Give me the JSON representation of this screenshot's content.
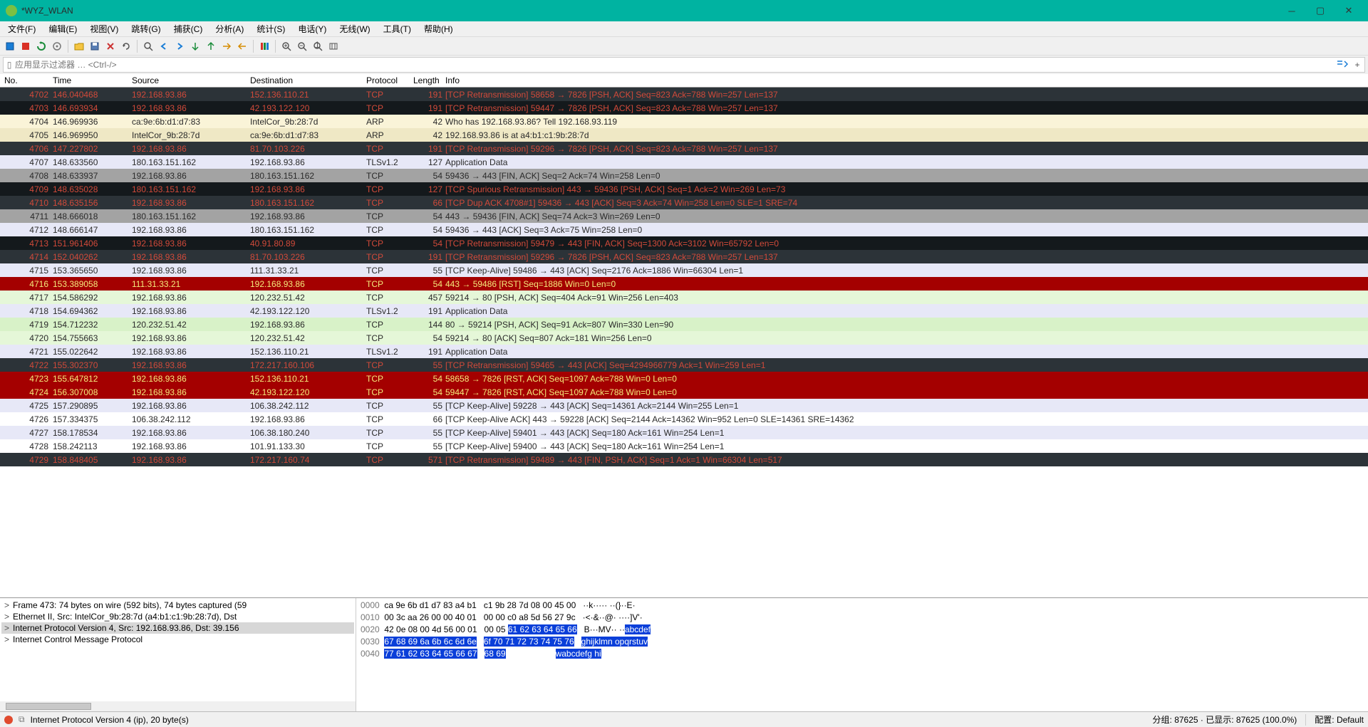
{
  "window": {
    "title": "*WYZ_WLAN"
  },
  "menu": {
    "items": [
      "文件(F)",
      "编辑(E)",
      "视图(V)",
      "跳转(G)",
      "捕获(C)",
      "分析(A)",
      "统计(S)",
      "电话(Y)",
      "无线(W)",
      "工具(T)",
      "帮助(H)"
    ]
  },
  "filter": {
    "placeholder": "应用显示过滤器 … <Ctrl-/>"
  },
  "columns": {
    "no": "No.",
    "time": "Time",
    "src": "Source",
    "dst": "Destination",
    "proto": "Protocol",
    "len": "Length",
    "info": "Info"
  },
  "packets": [
    {
      "no": "4702",
      "time": "146.040468",
      "src": "192.168.93.86",
      "dst": "152.136.110.21",
      "proto": "TCP",
      "len": "191",
      "info": "[TCP Retransmission] 58658 → 7826 [PSH, ACK] Seq=823 Ack=788 Win=257 Len=137",
      "cls": "cls-retrans-dark"
    },
    {
      "no": "4703",
      "time": "146.693934",
      "src": "192.168.93.86",
      "dst": "42.193.122.120",
      "proto": "TCP",
      "len": "191",
      "info": "[TCP Retransmission] 59447 → 7826 [PSH, ACK] Seq=823 Ack=788 Win=257 Len=137",
      "cls": "cls-retrans-dark2"
    },
    {
      "no": "4704",
      "time": "146.969936",
      "src": "ca:9e:6b:d1:d7:83",
      "dst": "IntelCor_9b:28:7d",
      "proto": "ARP",
      "len": "42",
      "info": "Who has 192.168.93.86? Tell 192.168.93.119",
      "cls": "cls-arp-light"
    },
    {
      "no": "4705",
      "time": "146.969950",
      "src": "IntelCor_9b:28:7d",
      "dst": "ca:9e:6b:d1:d7:83",
      "proto": "ARP",
      "len": "42",
      "info": "192.168.93.86 is at a4:b1:c1:9b:28:7d",
      "cls": "cls-arp-dark"
    },
    {
      "no": "4706",
      "time": "147.227802",
      "src": "192.168.93.86",
      "dst": "81.70.103.226",
      "proto": "TCP",
      "len": "191",
      "info": "[TCP Retransmission] 59296 → 7826 [PSH, ACK] Seq=823 Ack=788 Win=257 Len=137",
      "cls": "cls-retrans-dark"
    },
    {
      "no": "4707",
      "time": "148.633560",
      "src": "180.163.151.162",
      "dst": "192.168.93.86",
      "proto": "TLSv1.2",
      "len": "127",
      "info": "Application Data",
      "cls": "cls-light-blue"
    },
    {
      "no": "4708",
      "time": "148.633937",
      "src": "192.168.93.86",
      "dst": "180.163.151.162",
      "proto": "TCP",
      "len": "54",
      "info": "59436 → 443 [FIN, ACK] Seq=2 Ack=74 Win=258 Len=0",
      "cls": "cls-gray"
    },
    {
      "no": "4709",
      "time": "148.635028",
      "src": "180.163.151.162",
      "dst": "192.168.93.86",
      "proto": "TCP",
      "len": "127",
      "info": "[TCP Spurious Retransmission] 443 → 59436 [PSH, ACK] Seq=1 Ack=2 Win=269 Len=73",
      "cls": "cls-retrans-dark2"
    },
    {
      "no": "4710",
      "time": "148.635156",
      "src": "192.168.93.86",
      "dst": "180.163.151.162",
      "proto": "TCP",
      "len": "66",
      "info": "[TCP Dup ACK 4708#1] 59436 → 443 [ACK] Seq=3 Ack=74 Win=258 Len=0 SLE=1 SRE=74",
      "cls": "cls-retrans-dark"
    },
    {
      "no": "4711",
      "time": "148.666018",
      "src": "180.163.151.162",
      "dst": "192.168.93.86",
      "proto": "TCP",
      "len": "54",
      "info": "443 → 59436 [FIN, ACK] Seq=74 Ack=3 Win=269 Len=0",
      "cls": "cls-gray"
    },
    {
      "no": "4712",
      "time": "148.666147",
      "src": "192.168.93.86",
      "dst": "180.163.151.162",
      "proto": "TCP",
      "len": "54",
      "info": "59436 → 443 [ACK] Seq=3 Ack=75 Win=258 Len=0",
      "cls": "cls-light-blue"
    },
    {
      "no": "4713",
      "time": "151.961406",
      "src": "192.168.93.86",
      "dst": "40.91.80.89",
      "proto": "TCP",
      "len": "54",
      "info": "[TCP Retransmission] 59479 → 443 [FIN, ACK] Seq=1300 Ack=3102 Win=65792 Len=0",
      "cls": "cls-retrans-dark2"
    },
    {
      "no": "4714",
      "time": "152.040262",
      "src": "192.168.93.86",
      "dst": "81.70.103.226",
      "proto": "TCP",
      "len": "191",
      "info": "[TCP Retransmission] 59296 → 7826 [PSH, ACK] Seq=823 Ack=788 Win=257 Len=137",
      "cls": "cls-retrans-dark"
    },
    {
      "no": "4715",
      "time": "153.365650",
      "src": "192.168.93.86",
      "dst": "111.31.33.21",
      "proto": "TCP",
      "len": "55",
      "info": "[TCP Keep-Alive] 59486 → 443 [ACK] Seq=2176 Ack=1886 Win=66304 Len=1",
      "cls": "cls-light-blue"
    },
    {
      "no": "4716",
      "time": "153.389058",
      "src": "111.31.33.21",
      "dst": "192.168.93.86",
      "proto": "TCP",
      "len": "54",
      "info": "443 → 59486 [RST] Seq=1886 Win=0 Len=0",
      "cls": "cls-red-white"
    },
    {
      "no": "4717",
      "time": "154.586292",
      "src": "192.168.93.86",
      "dst": "120.232.51.42",
      "proto": "TCP",
      "len": "457",
      "info": "59214 → 80 [PSH, ACK] Seq=404 Ack=91 Win=256 Len=403",
      "cls": "cls-green-light"
    },
    {
      "no": "4718",
      "time": "154.694362",
      "src": "192.168.93.86",
      "dst": "42.193.122.120",
      "proto": "TLSv1.2",
      "len": "191",
      "info": "Application Data",
      "cls": "cls-light-blue"
    },
    {
      "no": "4719",
      "time": "154.712232",
      "src": "120.232.51.42",
      "dst": "192.168.93.86",
      "proto": "TCP",
      "len": "144",
      "info": "80 → 59214 [PSH, ACK] Seq=91 Ack=807 Win=330 Len=90",
      "cls": "cls-green-light2"
    },
    {
      "no": "4720",
      "time": "154.755663",
      "src": "192.168.93.86",
      "dst": "120.232.51.42",
      "proto": "TCP",
      "len": "54",
      "info": "59214 → 80 [ACK] Seq=807 Ack=181 Win=256 Len=0",
      "cls": "cls-green-light"
    },
    {
      "no": "4721",
      "time": "155.022642",
      "src": "192.168.93.86",
      "dst": "152.136.110.21",
      "proto": "TLSv1.2",
      "len": "191",
      "info": "Application Data",
      "cls": "cls-light-blue"
    },
    {
      "no": "4722",
      "time": "155.302370",
      "src": "192.168.93.86",
      "dst": "172.217.160.106",
      "proto": "TCP",
      "len": "55",
      "info": "[TCP Retransmission] 59465 → 443 [ACK] Seq=4294966779 Ack=1 Win=259 Len=1",
      "cls": "cls-retrans-dark"
    },
    {
      "no": "4723",
      "time": "155.647812",
      "src": "192.168.93.86",
      "dst": "152.136.110.21",
      "proto": "TCP",
      "len": "54",
      "info": "58658 → 7826 [RST, ACK] Seq=1097 Ack=788 Win=0 Len=0",
      "cls": "cls-red-white"
    },
    {
      "no": "4724",
      "time": "156.307008",
      "src": "192.168.93.86",
      "dst": "42.193.122.120",
      "proto": "TCP",
      "len": "54",
      "info": "59447 → 7826 [RST, ACK] Seq=1097 Ack=788 Win=0 Len=0",
      "cls": "cls-red-white"
    },
    {
      "no": "4725",
      "time": "157.290895",
      "src": "192.168.93.86",
      "dst": "106.38.242.112",
      "proto": "TCP",
      "len": "55",
      "info": "[TCP Keep-Alive] 59228 → 443 [ACK] Seq=14361 Ack=2144 Win=255 Len=1",
      "cls": "cls-light-blue"
    },
    {
      "no": "4726",
      "time": "157.334375",
      "src": "106.38.242.112",
      "dst": "192.168.93.86",
      "proto": "TCP",
      "len": "66",
      "info": "[TCP Keep-Alive ACK] 443 → 59228 [ACK] Seq=2144 Ack=14362 Win=952 Len=0 SLE=14361 SRE=14362",
      "cls": "cls-white"
    },
    {
      "no": "4727",
      "time": "158.178534",
      "src": "192.168.93.86",
      "dst": "106.38.180.240",
      "proto": "TCP",
      "len": "55",
      "info": "[TCP Keep-Alive] 59401 → 443 [ACK] Seq=180 Ack=161 Win=254 Len=1",
      "cls": "cls-light-blue"
    },
    {
      "no": "4728",
      "time": "158.242113",
      "src": "192.168.93.86",
      "dst": "101.91.133.30",
      "proto": "TCP",
      "len": "55",
      "info": "[TCP Keep-Alive] 59400 → 443 [ACK] Seq=180 Ack=161 Win=254 Len=1",
      "cls": "cls-white"
    },
    {
      "no": "4729",
      "time": "158.848405",
      "src": "192.168.93.86",
      "dst": "172.217.160.74",
      "proto": "TCP",
      "len": "571",
      "info": "[TCP Retransmission] 59489 → 443 [FIN, PSH, ACK] Seq=1 Ack=1 Win=66304 Len=517",
      "cls": "cls-retrans-dark"
    }
  ],
  "tree": {
    "lines": [
      {
        "exp": ">",
        "txt": "Frame 473: 74 bytes on wire (592 bits), 74 bytes captured (59",
        "sel": false
      },
      {
        "exp": ">",
        "txt": "Ethernet II, Src: IntelCor_9b:28:7d (a4:b1:c1:9b:28:7d), Dst",
        "sel": false
      },
      {
        "exp": ">",
        "txt": "Internet Protocol Version 4, Src: 192.168.93.86, Dst: 39.156",
        "sel": true
      },
      {
        "exp": ">",
        "txt": "Internet Control Message Protocol",
        "sel": false
      }
    ]
  },
  "hex": {
    "rows": [
      {
        "off": "0000",
        "b1": "ca 9e 6b d1 d7 83 a4 b1",
        "b2": "c1 9b 28 7d 08 00 45 00",
        "a": "··k····· ··(}··E·"
      },
      {
        "off": "0010",
        "b1": "00 3c aa 26 00 00 40 01",
        "b2": "00 00 c0 a8 5d 56 27 9c",
        "a": "·<·&··@· ····]V'·"
      },
      {
        "off": "0020",
        "b1": "42 0e 08 00 4d 56 00 01",
        "b2": "00 05 ",
        "b2s": "61 62 63 64 65 66",
        "a": "B···MV·· ··",
        "as": "abcdef"
      },
      {
        "off": "0030",
        "b1s": "67 68 69 6a 6b 6c 6d 6e",
        "b2s2": "6f 70 71 72 73 74 75 76",
        "as2": "ghijklmn opqrstuv"
      },
      {
        "off": "0040",
        "b1s2": "77 61 62 63 64 65 66 67",
        "b2s3": "68 69",
        "as3": "wabcdefg hi"
      }
    ]
  },
  "status": {
    "left": "Internet Protocol Version 4 (ip), 20 byte(s)",
    "mid": "分组: 87625 · 已显示: 87625 (100.0%)",
    "right": "配置: Default"
  }
}
